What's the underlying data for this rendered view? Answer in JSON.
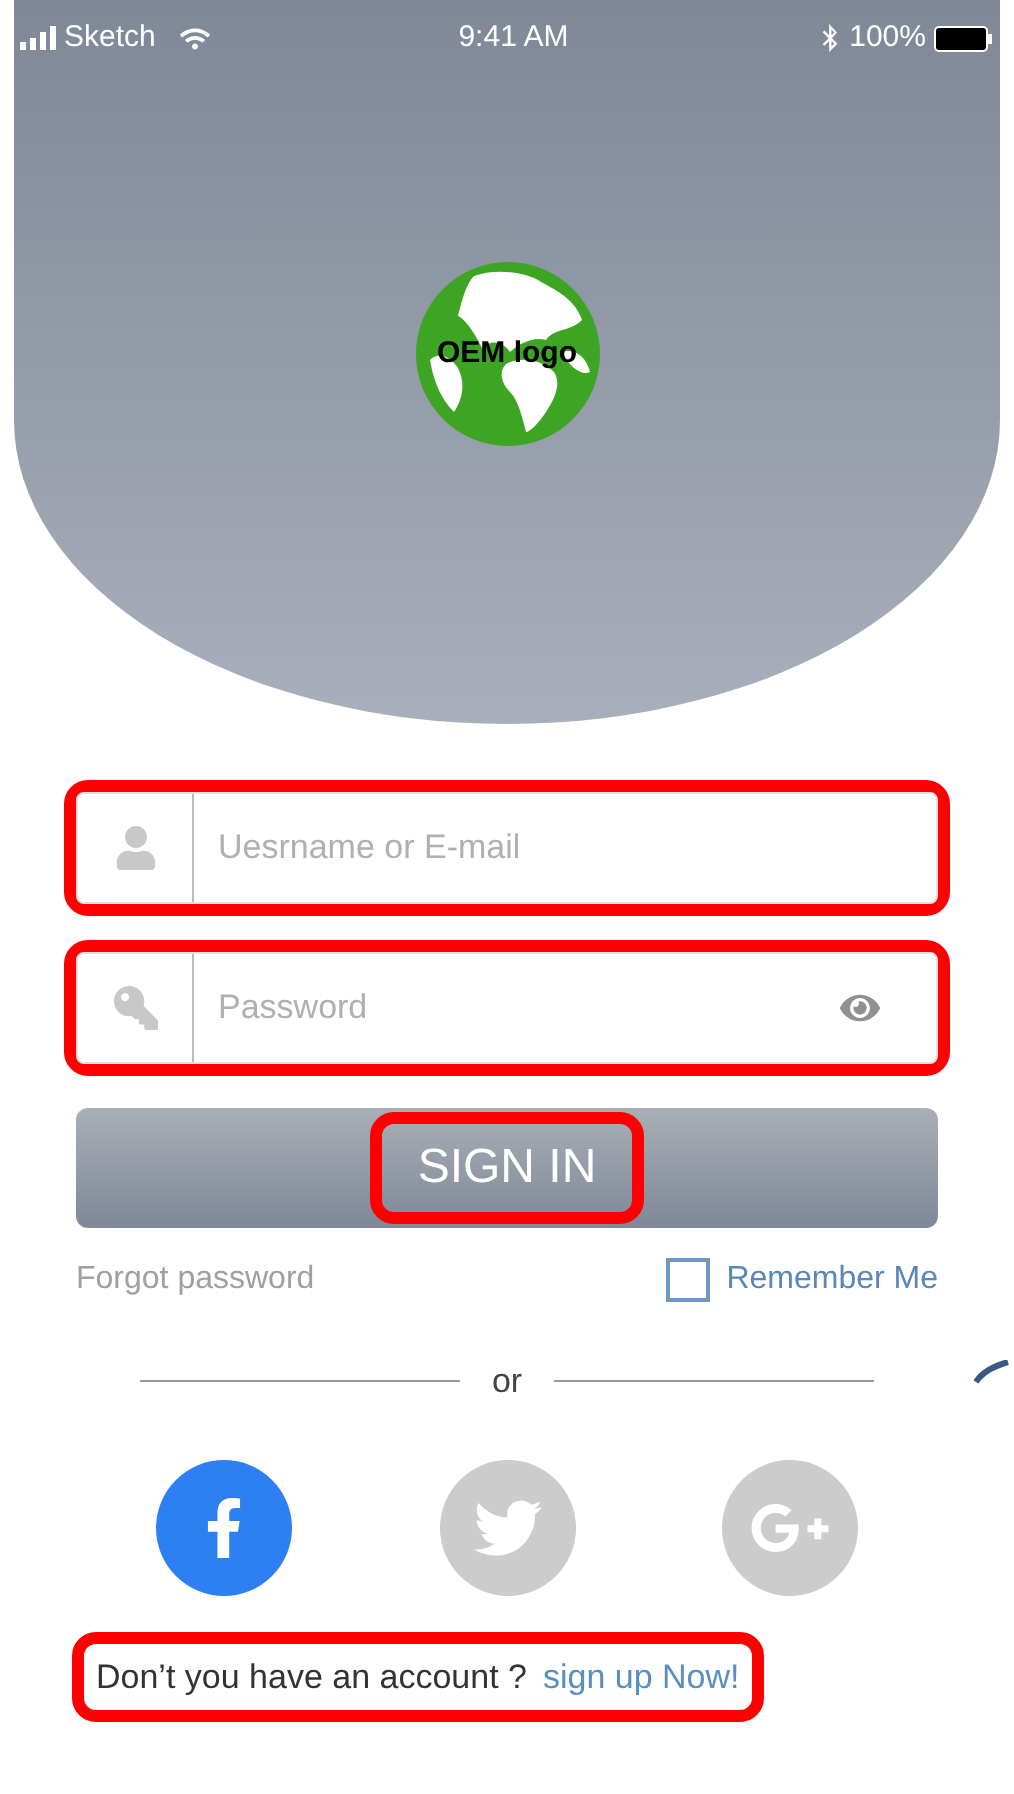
{
  "status_bar": {
    "carrier": "Sketch",
    "time": "9:41 AM",
    "battery": "100%"
  },
  "logo": {
    "text": "OEM logo"
  },
  "fields": [
    {
      "kind": "username",
      "placeholder": "Uesrname or E-mail",
      "highlighted": true
    },
    {
      "kind": "password",
      "placeholder": "Password",
      "highlighted": true
    }
  ],
  "sign_in": {
    "label": "SIGN IN",
    "highlighted": true
  },
  "forgot_password": "Forgot password",
  "remember_me": {
    "label": "Remember Me",
    "checked": false
  },
  "divider": "or",
  "social": [
    {
      "kind": "facebook",
      "selected": true
    },
    {
      "kind": "twitter",
      "selected": false
    },
    {
      "kind": "google",
      "selected": false
    }
  ],
  "signup": {
    "prompt": "Don’t you have an account ?",
    "link": "sign up Now!",
    "highlighted": true
  }
}
